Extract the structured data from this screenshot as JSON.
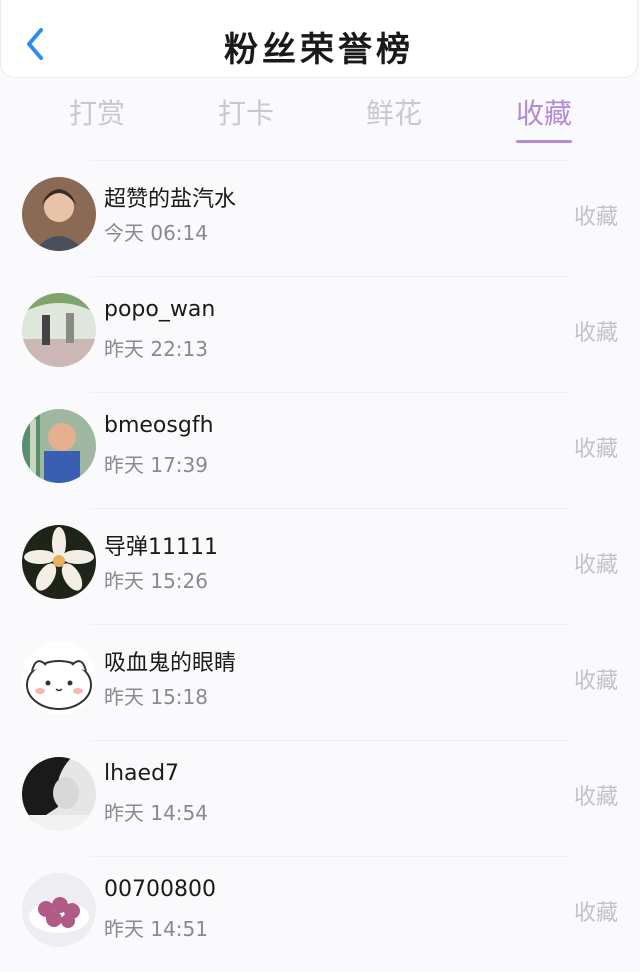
{
  "header": {
    "title": "粉丝荣誉榜",
    "back_icon": "chevron-left-icon",
    "accent": "#2d8cf0"
  },
  "tabs": [
    {
      "label": "打赏",
      "active": false
    },
    {
      "label": "打卡",
      "active": false
    },
    {
      "label": "鲜花",
      "active": false
    },
    {
      "label": "收藏",
      "active": true
    }
  ],
  "colors": {
    "active_tab": "#b28ad8",
    "inactive": "#c9c9cc"
  },
  "rows": [
    {
      "name": "超赞的盐汽水",
      "time": "今天 06:14",
      "action": "收藏"
    },
    {
      "name": "popo_wan",
      "time": "昨天 22:13",
      "action": "收藏"
    },
    {
      "name": "bmeosgfh",
      "time": "昨天 17:39",
      "action": "收藏"
    },
    {
      "name": "导弹11111",
      "time": "昨天 15:26",
      "action": "收藏"
    },
    {
      "name": "吸血鬼的眼睛",
      "time": "昨天 15:18",
      "action": "收藏"
    },
    {
      "name": "lhaed7",
      "time": "昨天 14:54",
      "action": "收藏"
    },
    {
      "name": "00700800",
      "time": "昨天 14:51",
      "action": "收藏"
    }
  ]
}
